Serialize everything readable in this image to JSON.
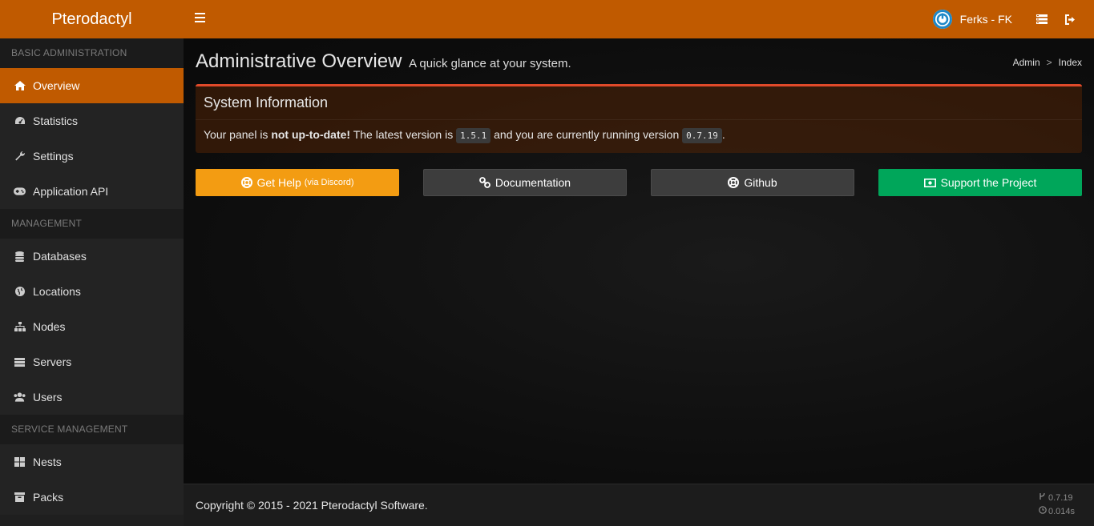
{
  "brand": "Pterodactyl",
  "user": {
    "name": "Ferks - FK"
  },
  "sidebar": {
    "sections": [
      {
        "header": "BASIC ADMINISTRATION",
        "items": [
          {
            "label": "Overview",
            "icon": "home-icon"
          },
          {
            "label": "Statistics",
            "icon": "dashboard-icon"
          },
          {
            "label": "Settings",
            "icon": "wrench-icon"
          },
          {
            "label": "Application API",
            "icon": "gamepad-icon"
          }
        ]
      },
      {
        "header": "MANAGEMENT",
        "items": [
          {
            "label": "Databases",
            "icon": "database-icon"
          },
          {
            "label": "Locations",
            "icon": "globe-icon"
          },
          {
            "label": "Nodes",
            "icon": "sitemap-icon"
          },
          {
            "label": "Servers",
            "icon": "server-icon"
          },
          {
            "label": "Users",
            "icon": "users-icon"
          }
        ]
      },
      {
        "header": "SERVICE MANAGEMENT",
        "items": [
          {
            "label": "Nests",
            "icon": "th-large-icon"
          },
          {
            "label": "Packs",
            "icon": "archive-icon"
          }
        ]
      }
    ]
  },
  "page": {
    "title": "Administrative Overview",
    "subtitle": "A quick glance at your system."
  },
  "breadcrumb": {
    "admin": "Admin",
    "separator": ">",
    "current": "Index"
  },
  "system_info": {
    "title": "System Information",
    "text_before": "Your panel is ",
    "status": "not up-to-date!",
    "text_mid": " The latest version is ",
    "latest_version": "1.5.1",
    "text_after": " and you are currently running version ",
    "current_version": "0.7.19",
    "text_end": "."
  },
  "buttons": {
    "help": "Get Help",
    "help_small": "(via Discord)",
    "docs": "Documentation",
    "github": "Github",
    "support": "Support the Project"
  },
  "footer": {
    "copyright": "Copyright © 2015 - 2021 Pterodactyl Software.",
    "version": "0.7.19",
    "load_time": "0.014s"
  },
  "colors": {
    "accent": "#c05a00",
    "help": "#f39c12",
    "support": "#00a65a",
    "alert_border": "#e04a2a"
  }
}
